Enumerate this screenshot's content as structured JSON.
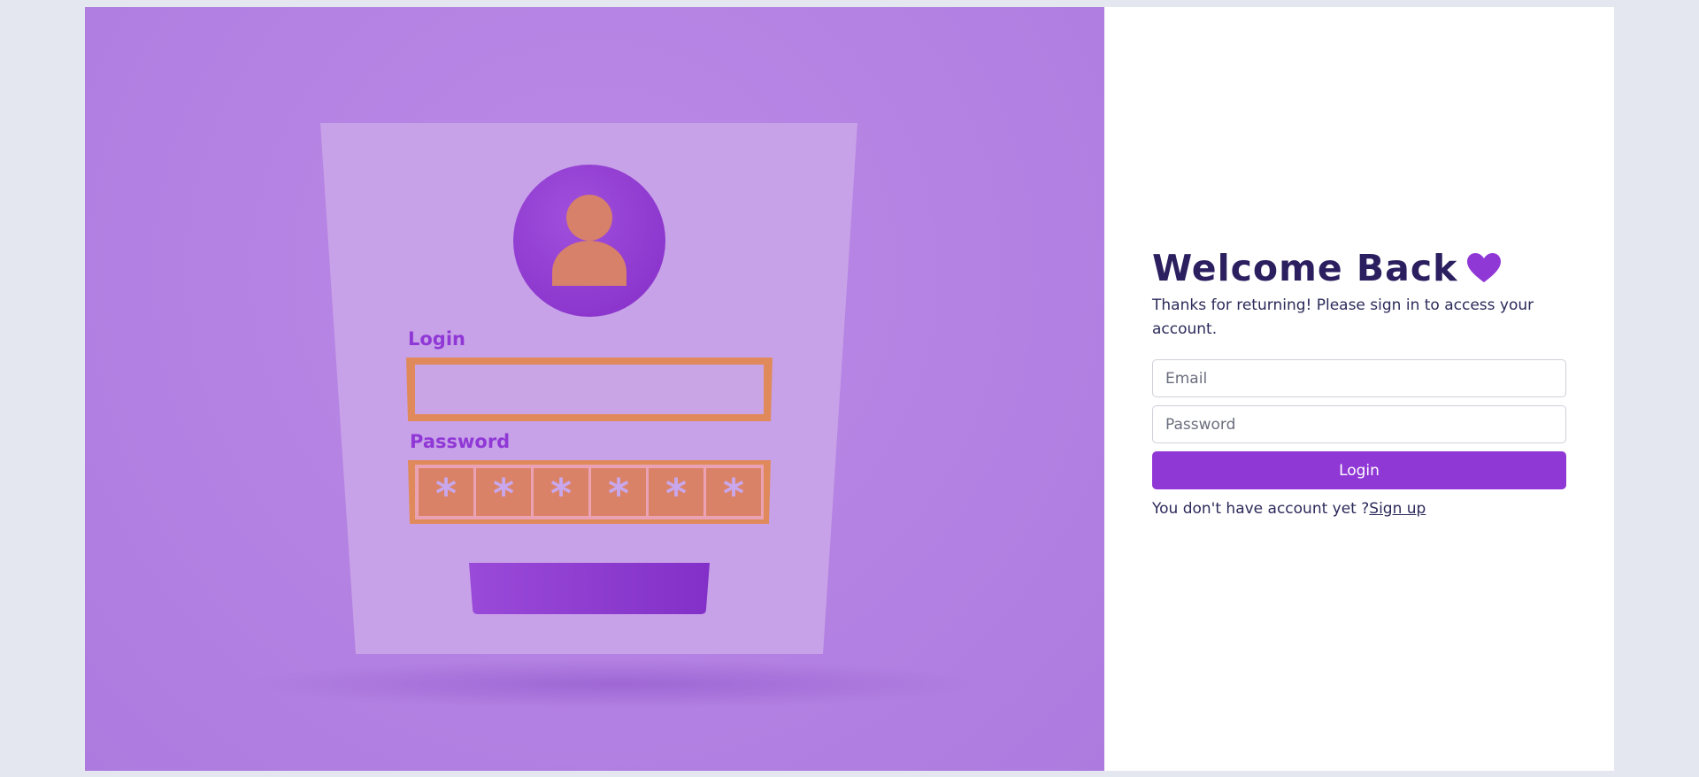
{
  "illustration": {
    "login_label": "Login",
    "password_label": "Password",
    "password_mask": [
      "*",
      "*",
      "*",
      "*",
      "*",
      "*"
    ]
  },
  "form": {
    "title": "Welcome Back",
    "title_icon": "heart-icon",
    "subtitle": "Thanks for returning! Please sign in to access your account.",
    "email_placeholder": "Email",
    "password_placeholder": "Password",
    "login_button": "Login",
    "no_account_text": "You don't have account yet ?",
    "signup_link": "Sign up"
  },
  "colors": {
    "accent": "#9038d6",
    "title": "#2b1f5f",
    "illustration_bg": "#b583e3",
    "orange": "#e0845c"
  }
}
